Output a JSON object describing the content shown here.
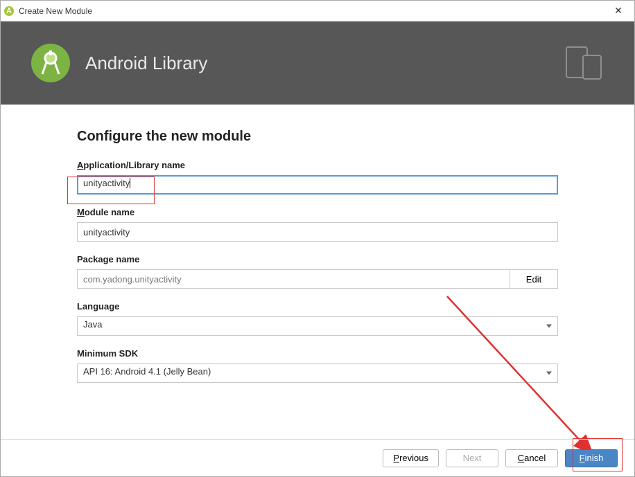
{
  "window": {
    "title": "Create New Module"
  },
  "banner": {
    "title": "Android Library"
  },
  "form": {
    "heading": "Configure the new module",
    "app_name_label_pre": "A",
    "app_name_label_rest": "pplication/Library name",
    "app_name_value": "unityactivity",
    "module_name_label_pre": "M",
    "module_name_label_rest": "odule name",
    "module_name_value": "unityactivity",
    "package_name_label": "Package name",
    "package_name_value": "com.yadong.unityactivity",
    "edit_label": "Edit",
    "language_label": "Language",
    "language_value": "Java",
    "min_sdk_label": "Minimum SDK",
    "min_sdk_value": "API 16: Android 4.1 (Jelly Bean)"
  },
  "footer": {
    "previous_pre": "P",
    "previous_rest": "revious",
    "next_label": "Next",
    "cancel_pre": "C",
    "cancel_rest": "ancel",
    "finish_pre": "F",
    "finish_rest": "inish"
  }
}
